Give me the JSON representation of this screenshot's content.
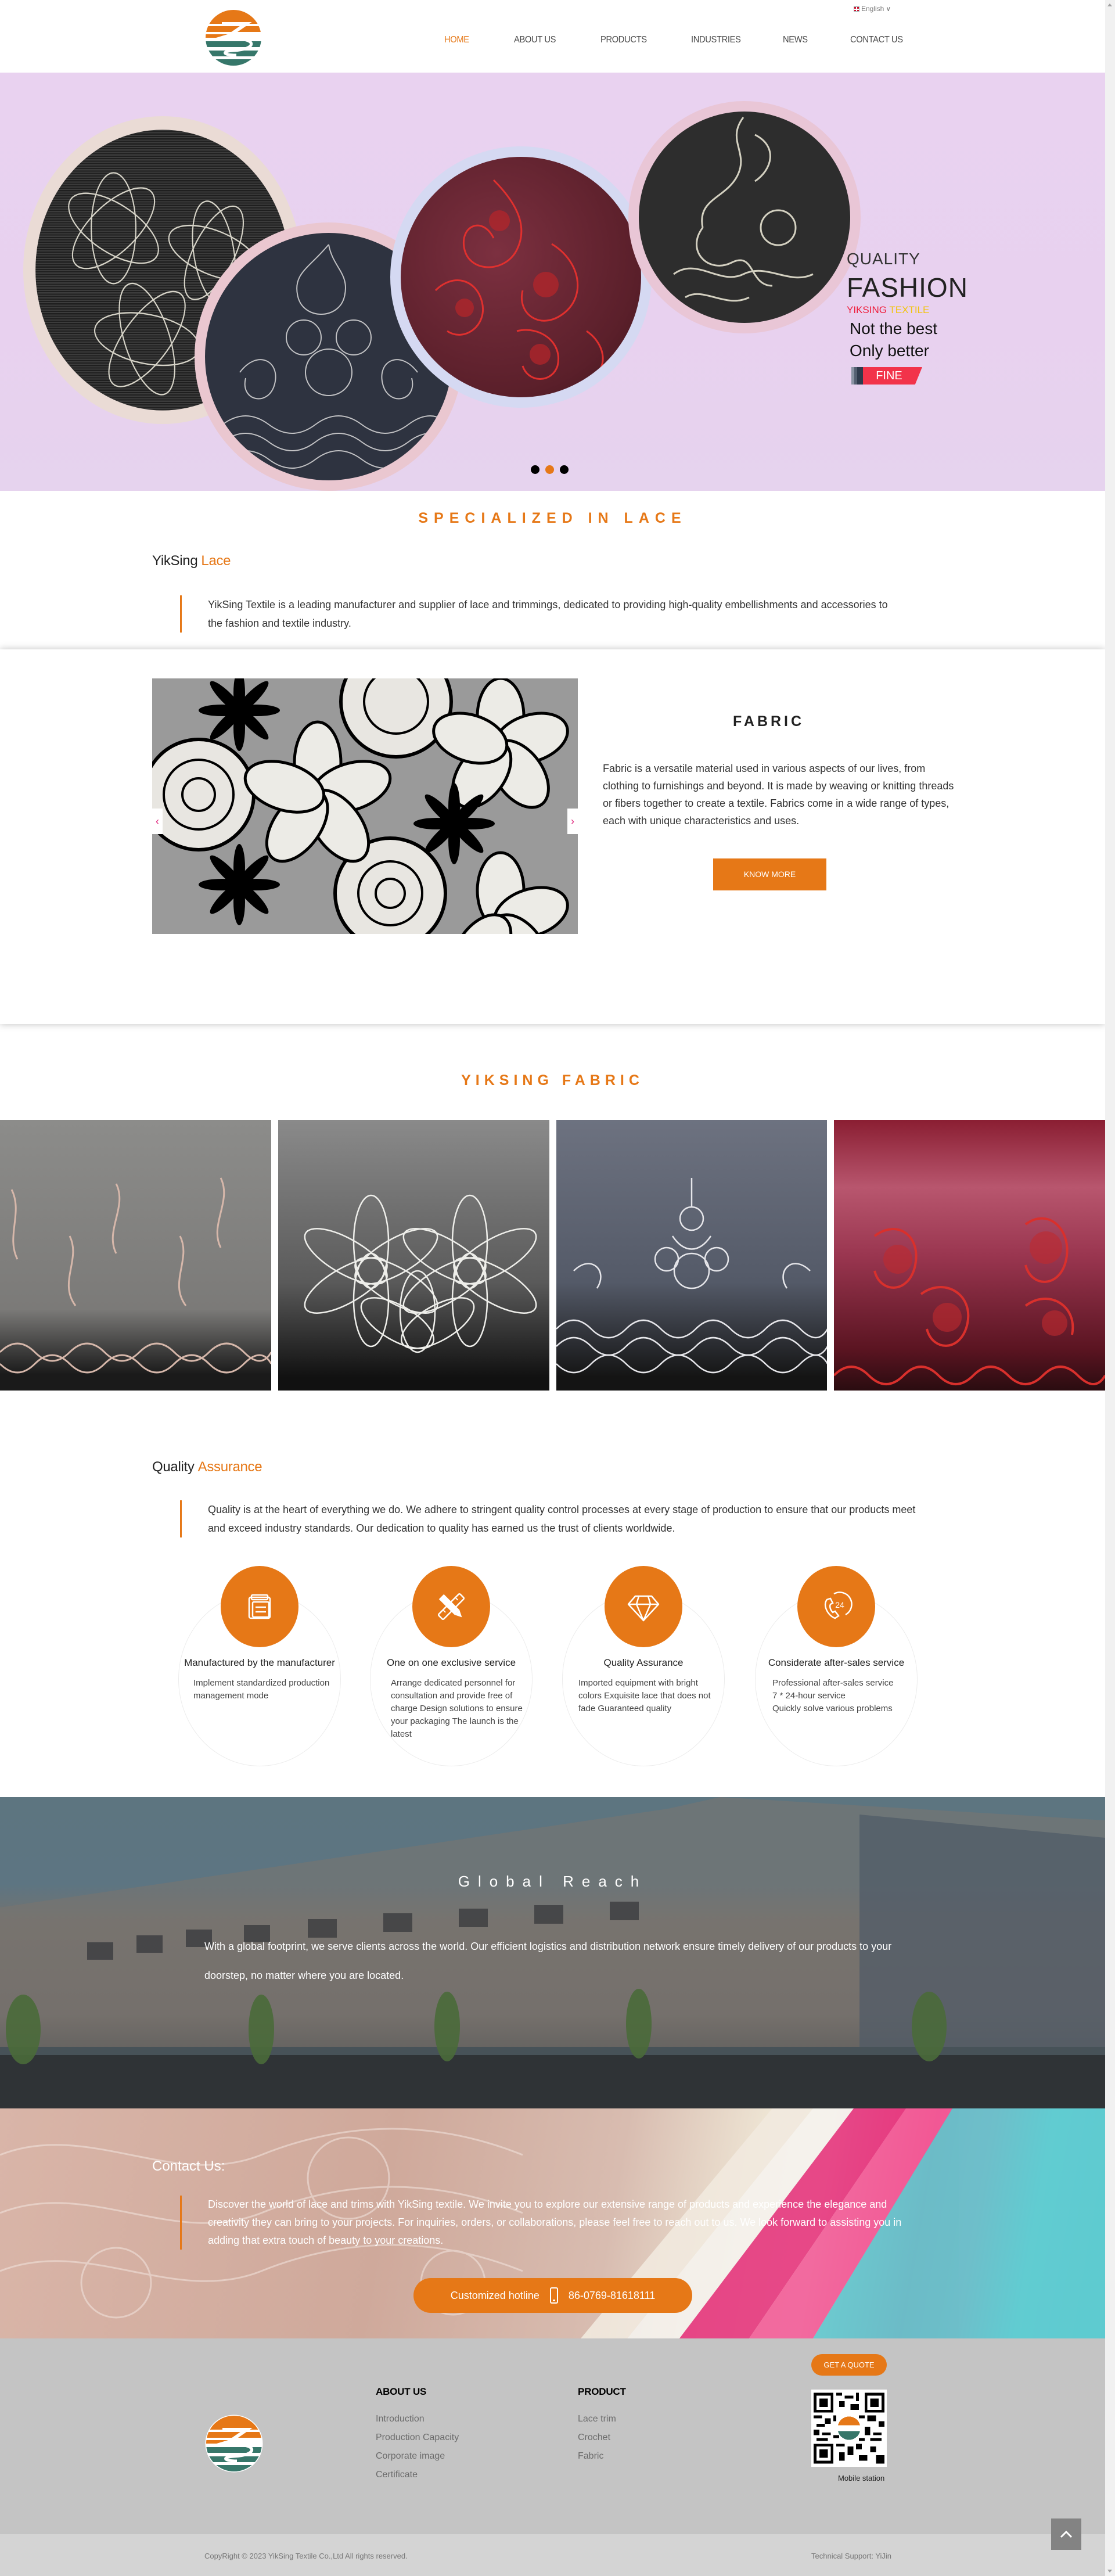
{
  "header": {
    "language": "English",
    "nav": [
      {
        "label": "HOME",
        "active": true
      },
      {
        "label": "ABOUT US",
        "active": false
      },
      {
        "label": "PRODUCTS",
        "active": false
      },
      {
        "label": "INDUSTRIES",
        "active": false
      },
      {
        "label": "NEWS",
        "active": false
      },
      {
        "label": "CONTACT US",
        "active": false
      }
    ]
  },
  "hero": {
    "line1": "QUALITY",
    "line2": "FASHION",
    "brand_red": "YIKSING",
    "brand_yellow": "TEXTILE",
    "line3": "Not the best",
    "line4": "Only better",
    "tag": "FINE",
    "slides": 3,
    "active_slide": 2
  },
  "specialized": {
    "title": "SPECIALIZED IN LACE",
    "subhead_main": "YikSing",
    "subhead_accent": "Lace",
    "text": "YikSing Textile is a leading manufacturer and supplier of lace and trimmings, dedicated to providing high-quality embellishments and accessories to the fashion and textile industry."
  },
  "fabric": {
    "title": "FABRIC",
    "text": "Fabric is a versatile material used in various aspects of our lives, from clothing to furnishings and beyond. It is made by weaving or knitting threads or fibers together to create a textile. Fabrics come in a wide range of types, each with unique characteristics and uses.",
    "button": "KNOW MORE",
    "prev": "‹",
    "next": "›"
  },
  "gallery": {
    "title": "YIKSING  FABRIC",
    "items": [
      "blush-floral-lace",
      "white-flower-lace",
      "navy-scroll-lace",
      "red-floral-lace"
    ]
  },
  "quality": {
    "subhead_main": "Quality",
    "subhead_accent": "Assurance",
    "text": "Quality is at the heart of everything we do. We adhere to stringent quality control processes at every stage of production to ensure that our products meet and exceed industry standards. Our dedication to quality has earned us the trust of clients worldwide.",
    "features": [
      {
        "icon": "document-stack-icon",
        "title": "Manufactured by the manufacturer",
        "desc": "Implement standardized production management mode"
      },
      {
        "icon": "pencil-ruler-icon",
        "title": "One on one exclusive service",
        "desc": "Arrange dedicated personnel for consultation and provide free of charge Design solutions to ensure your packaging The launch is the latest"
      },
      {
        "icon": "diamond-icon",
        "title": "Quality Assurance",
        "desc": "Imported equipment with bright colors Exquisite lace that does not fade Guaranteed quality"
      },
      {
        "icon": "phone-24h-icon",
        "title": "Considerate after-sales service",
        "desc": "Professional after-sales service\n7 * 24-hour service\nQuickly solve various problems"
      }
    ]
  },
  "global": {
    "title": "Global Reach",
    "text": "With a global footprint, we serve clients across the world. Our efficient logistics and distribution network ensure timely delivery of our products to your doorstep, no matter where you are located."
  },
  "contact": {
    "title": "Contact Us:",
    "text": "Discover the world of lace and trims with YikSing textile. We invite you to explore our extensive range of products and experience the elegance and creativity they can bring to your projects. For inquiries, orders, or collaborations, please feel free to reach out to us. We look forward to assisting you in adding that extra touch of beauty to your creations.",
    "hotline_label": "Customized hotline",
    "hotline_number": "86-0769-81618111"
  },
  "footer": {
    "about": {
      "title": "ABOUT US",
      "links": [
        "Introduction",
        "Production Capacity",
        "Corporate image",
        "Certificate"
      ]
    },
    "product": {
      "title": "PRODUCT",
      "links": [
        "Lace trim",
        "Crochet",
        "Fabric"
      ]
    },
    "quote_button": "GET A QUOTE",
    "qr_caption": "Mobile station",
    "copyright": "CopyRight © 2023 YikSing Textile Co.,Ltd All rights reserved.",
    "tech_support": "Technical Support:  YiJin"
  },
  "colors": {
    "accent": "#e67817",
    "nav_text": "#4a4a4a",
    "footer_bg": "#c4c4c4"
  }
}
